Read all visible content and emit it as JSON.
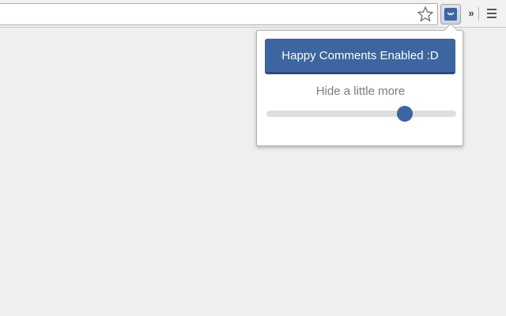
{
  "toolbar": {
    "overflow_label": "»",
    "icons": {
      "bookmark": "star-icon",
      "extension": "happy-comments-extension-icon",
      "menu": "hamburger-menu-icon"
    }
  },
  "popup": {
    "enable_button_label": "Happy Comments Enabled :D",
    "slider_label": "Hide a little more",
    "slider_value": 0.73
  },
  "colors": {
    "accent": "#3d66a0",
    "page_background": "#efefef",
    "label_text": "#7a7a7a"
  }
}
